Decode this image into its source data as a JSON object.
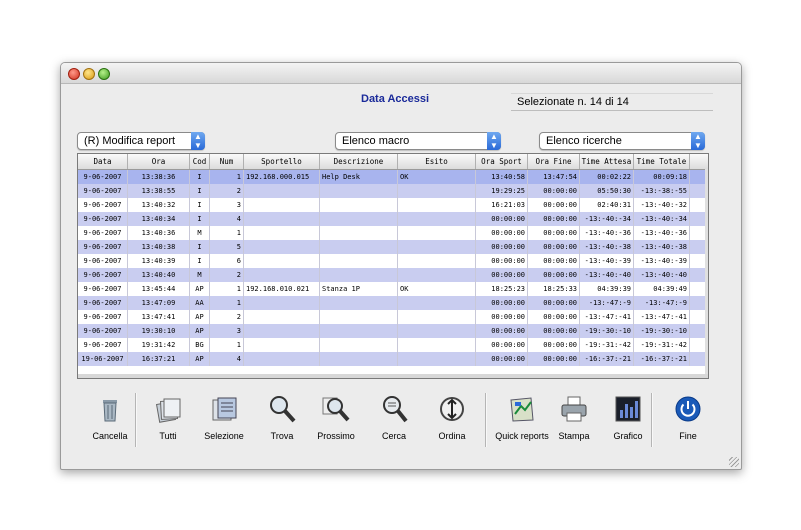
{
  "window": {
    "title": "Data Accessi",
    "status": "Selezionate n. 14 di 14"
  },
  "popups": {
    "report": "(R) Modifica report",
    "macro": "Elenco macro",
    "ricerche": "Elenco ricerche"
  },
  "table": {
    "columns": [
      "Data",
      "Ora",
      "Cod",
      "Num",
      "Sportello",
      "Descrizione",
      "Esito",
      "Ora Sport",
      "Ora Fine",
      "Time Attesa",
      "Time Totale"
    ],
    "rows": [
      [
        "9-06-2007",
        "13:38:36",
        "I",
        "1",
        "192.168.000.015",
        "Help Desk",
        "OK",
        "13:40:58",
        "13:47:54",
        "00:02:22",
        "00:09:18"
      ],
      [
        "9-06-2007",
        "13:38:55",
        "I",
        "2",
        "",
        "",
        "",
        "19:29:25",
        "00:00:00",
        "05:50:30",
        "-13:-38:-55"
      ],
      [
        "9-06-2007",
        "13:40:32",
        "I",
        "3",
        "",
        "",
        "",
        "16:21:03",
        "00:00:00",
        "02:40:31",
        "-13:-40:-32"
      ],
      [
        "9-06-2007",
        "13:40:34",
        "I",
        "4",
        "",
        "",
        "",
        "00:00:00",
        "00:00:00",
        "-13:-40:-34",
        "-13:-40:-34"
      ],
      [
        "9-06-2007",
        "13:40:36",
        "M",
        "1",
        "",
        "",
        "",
        "00:00:00",
        "00:00:00",
        "-13:-40:-36",
        "-13:-40:-36"
      ],
      [
        "9-06-2007",
        "13:40:38",
        "I",
        "5",
        "",
        "",
        "",
        "00:00:00",
        "00:00:00",
        "-13:-40:-38",
        "-13:-40:-38"
      ],
      [
        "9-06-2007",
        "13:40:39",
        "I",
        "6",
        "",
        "",
        "",
        "00:00:00",
        "00:00:00",
        "-13:-40:-39",
        "-13:-40:-39"
      ],
      [
        "9-06-2007",
        "13:40:40",
        "M",
        "2",
        "",
        "",
        "",
        "00:00:00",
        "00:00:00",
        "-13:-40:-40",
        "-13:-40:-40"
      ],
      [
        "9-06-2007",
        "13:45:44",
        "AP",
        "1",
        "192.168.010.021",
        "Stanza 1P",
        "OK",
        "18:25:23",
        "18:25:33",
        "04:39:39",
        "04:39:49"
      ],
      [
        "9-06-2007",
        "13:47:09",
        "AA",
        "1",
        "",
        "",
        "",
        "00:00:00",
        "00:00:00",
        "-13:-47:-9",
        "-13:-47:-9"
      ],
      [
        "9-06-2007",
        "13:47:41",
        "AP",
        "2",
        "",
        "",
        "",
        "00:00:00",
        "00:00:00",
        "-13:-47:-41",
        "-13:-47:-41"
      ],
      [
        "9-06-2007",
        "19:30:10",
        "AP",
        "3",
        "",
        "",
        "",
        "00:00:00",
        "00:00:00",
        "-19:-30:-10",
        "-19:-30:-10"
      ],
      [
        "9-06-2007",
        "19:31:42",
        "BG",
        "1",
        "",
        "",
        "",
        "00:00:00",
        "00:00:00",
        "-19:-31:-42",
        "-19:-31:-42"
      ],
      [
        "19-06-2007",
        "16:37:21",
        "AP",
        "4",
        "",
        "",
        "",
        "00:00:00",
        "00:00:00",
        "-16:-37:-21",
        "-16:-37:-21"
      ]
    ]
  },
  "toolbar": [
    {
      "name": "cancella",
      "label": "Cancella",
      "icon": "trash-icon"
    },
    {
      "name": "tutti",
      "label": "Tutti",
      "icon": "stack-icon"
    },
    {
      "name": "selezione",
      "label": "Selezione",
      "icon": "selection-icon"
    },
    {
      "name": "trova",
      "label": "Trova",
      "icon": "magnifier-icon"
    },
    {
      "name": "prossimo",
      "label": "Prossimo",
      "icon": "magnifier-next-icon"
    },
    {
      "name": "cerca",
      "label": "Cerca",
      "icon": "magnifier-search-icon"
    },
    {
      "name": "ordina",
      "label": "Ordina",
      "icon": "sort-icon"
    },
    {
      "name": "quick-reports",
      "label": "Quick reports",
      "icon": "report-icon"
    },
    {
      "name": "stampa",
      "label": "Stampa",
      "icon": "printer-icon"
    },
    {
      "name": "grafico",
      "label": "Grafico",
      "icon": "chart-icon"
    },
    {
      "name": "fine",
      "label": "Fine",
      "icon": "power-icon"
    }
  ],
  "colors": {
    "title": "#1a2a9a",
    "row_alt": "#c9cdf0",
    "row_selected": "#a8b4ee",
    "popup_arrow": "#2a6ad8"
  }
}
